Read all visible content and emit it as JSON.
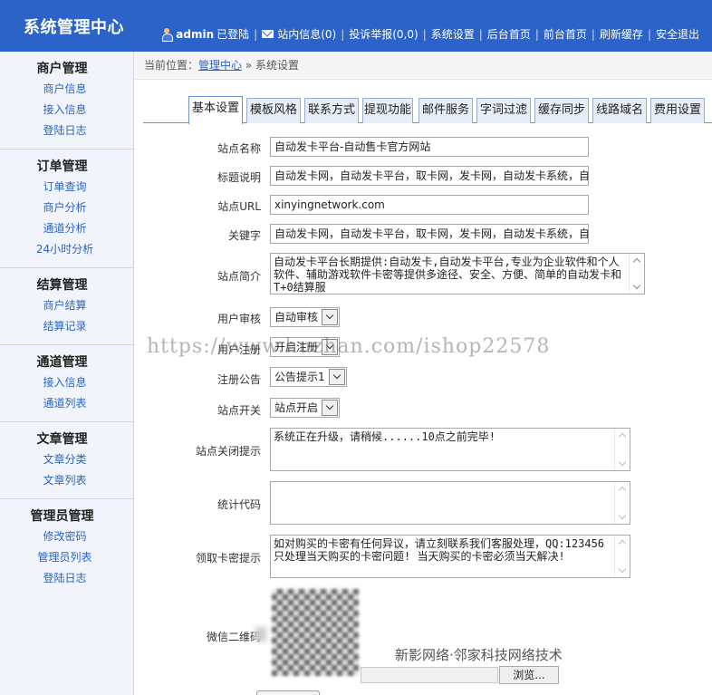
{
  "header": {
    "title": "系统管理中心",
    "user": "admin",
    "logged_in": "已登陆",
    "nav": [
      "站内信息(0)",
      "投诉举报(0,0)",
      "系统设置",
      "后台首页",
      "前台首页",
      "刷新缓存",
      "安全退出"
    ]
  },
  "sidebar": {
    "groups": [
      {
        "title": "商户管理",
        "items": [
          "商户信息",
          "接入信息",
          "登陆日志"
        ]
      },
      {
        "title": "订单管理",
        "items": [
          "订单查询",
          "商户分析",
          "通道分析",
          "24小时分析"
        ]
      },
      {
        "title": "结算管理",
        "items": [
          "商户结算",
          "结算记录"
        ]
      },
      {
        "title": "通道管理",
        "items": [
          "接入信息",
          "通道列表"
        ]
      },
      {
        "title": "文章管理",
        "items": [
          "文章分类",
          "文章列表"
        ]
      },
      {
        "title": "管理员管理",
        "items": [
          "修改密码",
          "管理员列表",
          "登陆日志"
        ]
      }
    ]
  },
  "breadcrumb": {
    "prefix": "当前位置：",
    "link": "管理中心",
    "separator": "»",
    "current": "系统设置"
  },
  "tabs": [
    "基本设置",
    "模板风格",
    "联系方式",
    "提现功能",
    "邮件服务",
    "字词过滤",
    "缓存同步",
    "线路域名",
    "费用设置"
  ],
  "active_tab": 0,
  "form": {
    "site_name": {
      "label": "站点名称",
      "value": "自动发卡平台-自动售卡官方网站"
    },
    "title_desc": {
      "label": "标题说明",
      "value": "自动发卡网，自动发卡平台，取卡网，发卡网，自动发卡系统，自"
    },
    "site_url": {
      "label": "站点URL",
      "value": "xinyingnetwork.com"
    },
    "keywords": {
      "label": "关键字",
      "value": "自动发卡网，自动发卡平台，取卡网，发卡网，自动发卡系统，自"
    },
    "site_intro": {
      "label": "站点简介",
      "value": "自动发卡平台长期提供:自动发卡,自动发卡平台,专业为企业软件和个人软件、辅助游戏软件卡密等提供多途径、安全、方便、简单的自动发卡和T+0结算服"
    },
    "user_review": {
      "label": "用户审核",
      "value": "自动审核"
    },
    "user_register": {
      "label": "用户注册",
      "value": "开启注册"
    },
    "register_notice": {
      "label": "注册公告",
      "value": "公告提示1"
    },
    "site_switch": {
      "label": "站点开关",
      "value": "站点开启"
    },
    "close_tip": {
      "label": "站点关闭提示",
      "value": "系统正在升级，请稍候......10点之前完毕!"
    },
    "stats_code": {
      "label": "统计代码",
      "value": ""
    },
    "card_tip": {
      "label": "领取卡密提示",
      "value": "如对购买的卡密有任何异议，请立刻联系我们客服处理，QQ:123456 只处理当天购买的卡密问题! 当天购买的卡密必须当天解决!"
    },
    "wechat_qr": {
      "label": "微信二维码"
    },
    "browse_label": "浏览..."
  },
  "watermark": "https://www.huzhan.com/ishop22578",
  "company": "新影网络·邻家科技网络技术",
  "colors": {
    "header": "#2b63c9",
    "link": "#2b63c9",
    "sidebar_bg": "#f1f5fb"
  }
}
